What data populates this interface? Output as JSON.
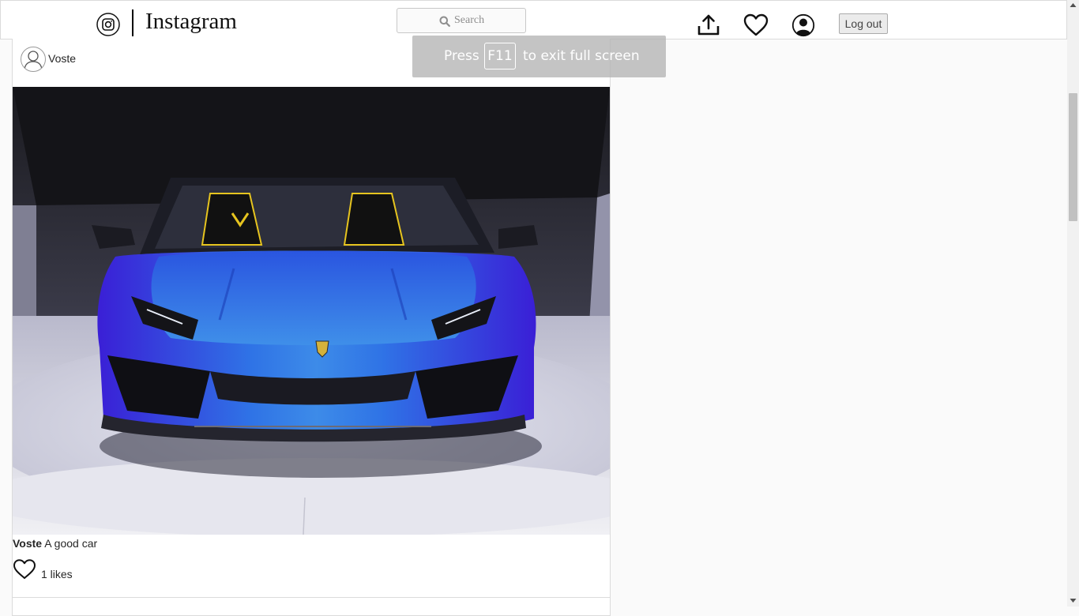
{
  "header": {
    "brand": "Instagram",
    "search": {
      "placeholder": "Search",
      "value": ""
    },
    "icons": [
      "instagram-icon",
      "upload-icon",
      "heart-icon",
      "profile-icon"
    ],
    "logout_label": "Log out"
  },
  "post": {
    "username": "Voste",
    "image_alt": "Blue sports car",
    "caption_user": "Voste",
    "caption_text": " A good car",
    "likes_text": "1 likes"
  },
  "fullscreen_toast": {
    "before": "Press",
    "key": "F11",
    "after": "to exit full screen"
  },
  "colors": {
    "background": "#fafafa",
    "border": "#dbdbdb",
    "car_blue": "#2f5ee8"
  }
}
